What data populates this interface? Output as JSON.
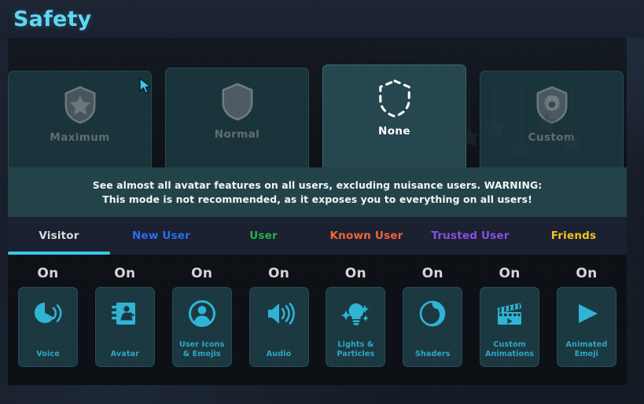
{
  "header": {
    "title": "Safety",
    "title_color": "#5fd8f2"
  },
  "modes": [
    {
      "label": "Maximum",
      "icon": "shield-star-icon",
      "selected": false
    },
    {
      "label": "Normal",
      "icon": "shield-solid-icon",
      "selected": false
    },
    {
      "label": "None",
      "icon": "shield-dashed-icon",
      "selected": true
    },
    {
      "label": "Custom",
      "icon": "shield-gear-icon",
      "selected": false
    }
  ],
  "warning": {
    "line1": "See almost all avatar features on all users, excluding nuisance users. WARNING:",
    "line2": "This mode is not recommended, as it exposes you to everything on all users!",
    "background": "#214148"
  },
  "tabs": [
    {
      "label": "Visitor",
      "color": "#d8dcde",
      "active": true,
      "width": 130
    },
    {
      "label": "New User",
      "color": "#2a6df0",
      "active": false,
      "width": 130
    },
    {
      "label": "User",
      "color": "#22b14c",
      "active": false,
      "width": 130
    },
    {
      "label": "Known User",
      "color": "#f4623a",
      "active": false,
      "width": 132
    },
    {
      "label": "Trusted User",
      "color": "#8a4fe0",
      "active": false,
      "width": 132
    },
    {
      "label": "Friends",
      "color": "#f0c420",
      "active": false,
      "width": 131
    }
  ],
  "tab_indicator_color": "#36c8e8",
  "toggles": [
    {
      "state": "On",
      "label": "Voice",
      "icon": "voice-icon"
    },
    {
      "state": "On",
      "label": "Avatar",
      "icon": "avatar-icon"
    },
    {
      "state": "On",
      "label": "User Icons\n& Emojis",
      "icon": "user-icons-emojis-icon"
    },
    {
      "state": "On",
      "label": "Audio",
      "icon": "audio-icon"
    },
    {
      "state": "On",
      "label": "Lights &\nParticles",
      "icon": "lights-particles-icon"
    },
    {
      "state": "On",
      "label": "Shaders",
      "icon": "shaders-icon"
    },
    {
      "state": "On",
      "label": "Custom\nAnimations",
      "icon": "custom-animations-icon"
    },
    {
      "state": "On",
      "label": "Animated\nEmoji",
      "icon": "animated-emoji-icon"
    }
  ],
  "colors": {
    "accent": "#36c8e8",
    "icon_cyan": "#2fb4d4",
    "card_unselected": "#18323a",
    "card_selected": "#24454d",
    "panel_bg": "#0b0e13"
  },
  "cursor": {
    "icon": "mouse-pointer-icon",
    "color": "#36c8e8"
  }
}
